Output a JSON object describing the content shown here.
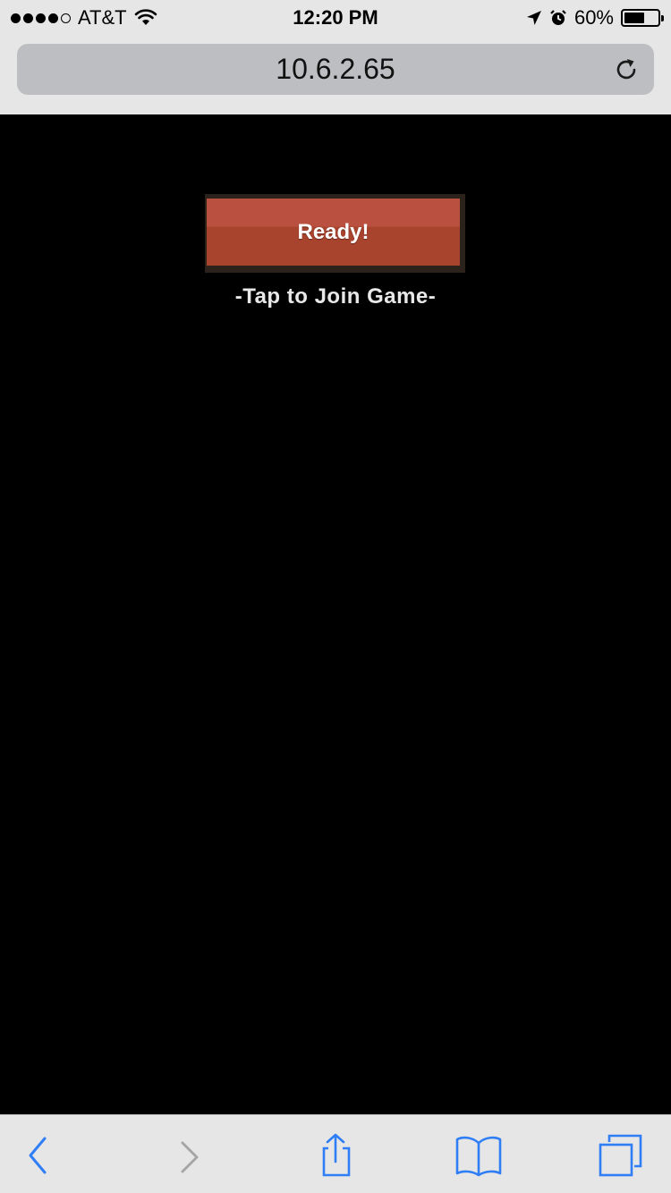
{
  "status_bar": {
    "carrier": "AT&T",
    "signal_bars_filled": 4,
    "signal_bars_total": 5,
    "time": "12:20 PM",
    "battery_percent_label": "60%",
    "battery_level": 0.6,
    "icons": [
      "wifi-icon",
      "location-arrow-icon",
      "alarm-icon",
      "battery-icon"
    ]
  },
  "browser": {
    "url": "10.6.2.65",
    "reload_icon": "reload-icon"
  },
  "game": {
    "ready_button_label": "Ready!",
    "join_hint": "-Tap to Join Game-",
    "colors": {
      "button_top": "#ba5040",
      "button_bottom": "#a8432e",
      "button_frame": "#2b221c",
      "background": "#000000"
    }
  },
  "toolbar": {
    "icons": [
      "back-icon",
      "forward-icon",
      "share-icon",
      "bookmarks-icon",
      "tabs-icon"
    ],
    "accent_color": "#2f7ef5",
    "disabled_color": "#a6a6a6"
  }
}
